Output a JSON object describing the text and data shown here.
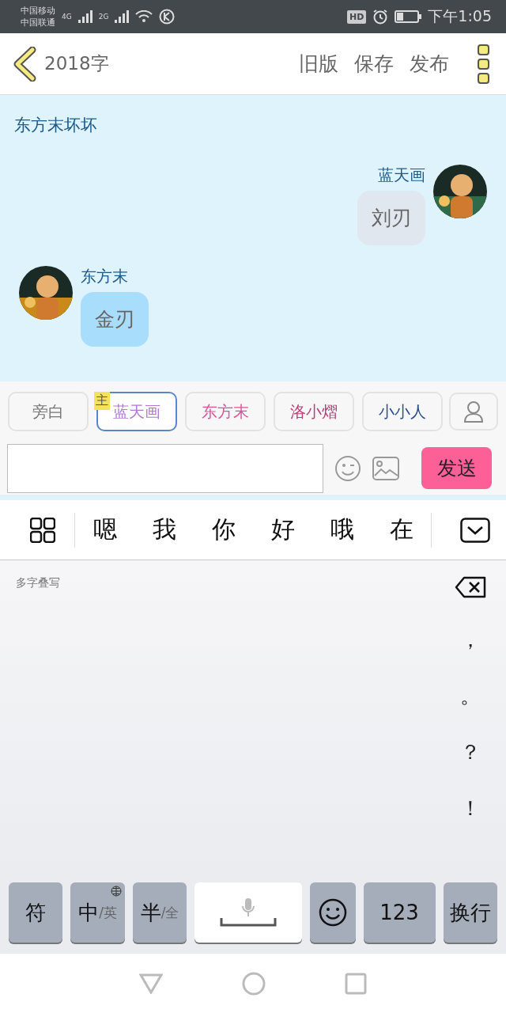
{
  "status_bar": {
    "carriers": [
      "中国移动",
      "中国联通"
    ],
    "network_1": "4G",
    "network_2": "2G",
    "hd": "HD",
    "time": "下午1:05"
  },
  "header": {
    "count": "2018字",
    "actions": [
      "旧版",
      "保存",
      "发布"
    ]
  },
  "chat": {
    "narration": "东方末坏坏",
    "messages": [
      {
        "outgoing": true,
        "sender": "蓝天画",
        "text": "刘刃"
      },
      {
        "outgoing": false,
        "sender": "东方末",
        "text": "金刃"
      }
    ]
  },
  "characters": [
    {
      "name": "旁白",
      "color": "#777777",
      "selected": false
    },
    {
      "name": "蓝天画",
      "color": "#b07ad0",
      "selected": true,
      "badge": "主"
    },
    {
      "name": "东方末",
      "color": "#d9559a",
      "selected": false
    },
    {
      "name": "洛小熠",
      "color": "#b8407a",
      "selected": false
    },
    {
      "name": "小小人",
      "color": "#2a4f8a",
      "selected": false
    }
  ],
  "composer": {
    "send": "发送"
  },
  "keyboard": {
    "candidates": [
      "嗯",
      "我",
      "你",
      "好",
      "哦",
      "在"
    ],
    "hint": "多字叠写",
    "punctuation": [
      "，",
      "。",
      "？",
      "！"
    ],
    "keys": [
      {
        "kind": "text",
        "label": "符"
      },
      {
        "kind": "lang",
        "label": "中",
        "sub": "/英"
      },
      {
        "kind": "lang",
        "label": "半",
        "sub": "/全"
      },
      {
        "kind": "space"
      },
      {
        "kind": "emoji"
      },
      {
        "kind": "text",
        "label": "123"
      },
      {
        "kind": "text",
        "label": "换行"
      }
    ]
  }
}
